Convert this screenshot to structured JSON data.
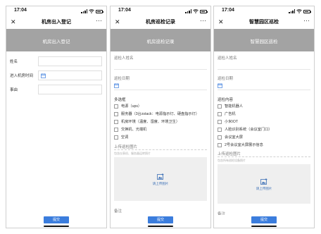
{
  "status": {
    "time": "17:04"
  },
  "icons": {
    "close": "close-icon",
    "more": "more-icon",
    "calendar": "calendar-icon",
    "image": "image-upload-icon"
  },
  "colors": {
    "header_band": "#a3a3a3",
    "submit": "#3b7ddd",
    "upload_text": "#3b6fb6"
  },
  "phone1": {
    "nav_title": "机房出入登记",
    "header_title": "机房出入登记",
    "fields": [
      {
        "label": "姓名"
      },
      {
        "label": "进入机房时间"
      },
      {
        "label": "事由"
      }
    ],
    "submit_label": "提交"
  },
  "phone2": {
    "nav_title": "机房巡检记录",
    "header_title": "机房巡检记录",
    "name_label": "巡检人姓名",
    "date_label": "巡检日期",
    "multi_label": "多选框",
    "options": [
      "电源（ups）",
      "服务器（3台zstack：电源指示灯、硬盘指示灯）",
      "机房环境（温度、湿度、环境卫生）",
      "交换机、光端机",
      "空调"
    ],
    "upload_label": "上传巡检图片",
    "upload_hint": "包含仪表机、服务器运转照片",
    "upload_text": "请上传图片",
    "remark_label": "备注",
    "submit_label": "提交"
  },
  "phone3": {
    "nav_title": "智慧园区巡检",
    "header_title": "智慧园区巡检",
    "name_label": "巡检人姓名",
    "date_label": "巡检日期",
    "content_label": "巡检内容",
    "options": [
      "智能机器人",
      "广告机",
      "小米IOT",
      "人脸识别系统（会议室门口）",
      "会议室大屏",
      "2号会议室大屏展示信息"
    ],
    "upload_label": "上传巡检图片",
    "upload_hint": "包含所有巡检设备照片",
    "upload_text": "请上传图片",
    "remark_label": "备注",
    "submit_label": "提交"
  }
}
